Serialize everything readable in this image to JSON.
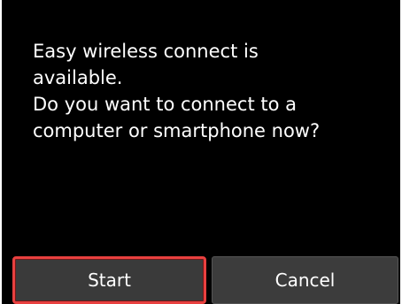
{
  "dialog": {
    "message_lines": [
      "Easy wireless connect is",
      "available.",
      "Do you want to connect to a",
      "computer or smartphone now?"
    ]
  },
  "buttons": {
    "start_label": "Start",
    "cancel_label": "Cancel"
  },
  "colors": {
    "background": "#000000",
    "text": "#ffffff",
    "button_fill": "#3c3c3c",
    "focus_border": "#e8403f"
  }
}
